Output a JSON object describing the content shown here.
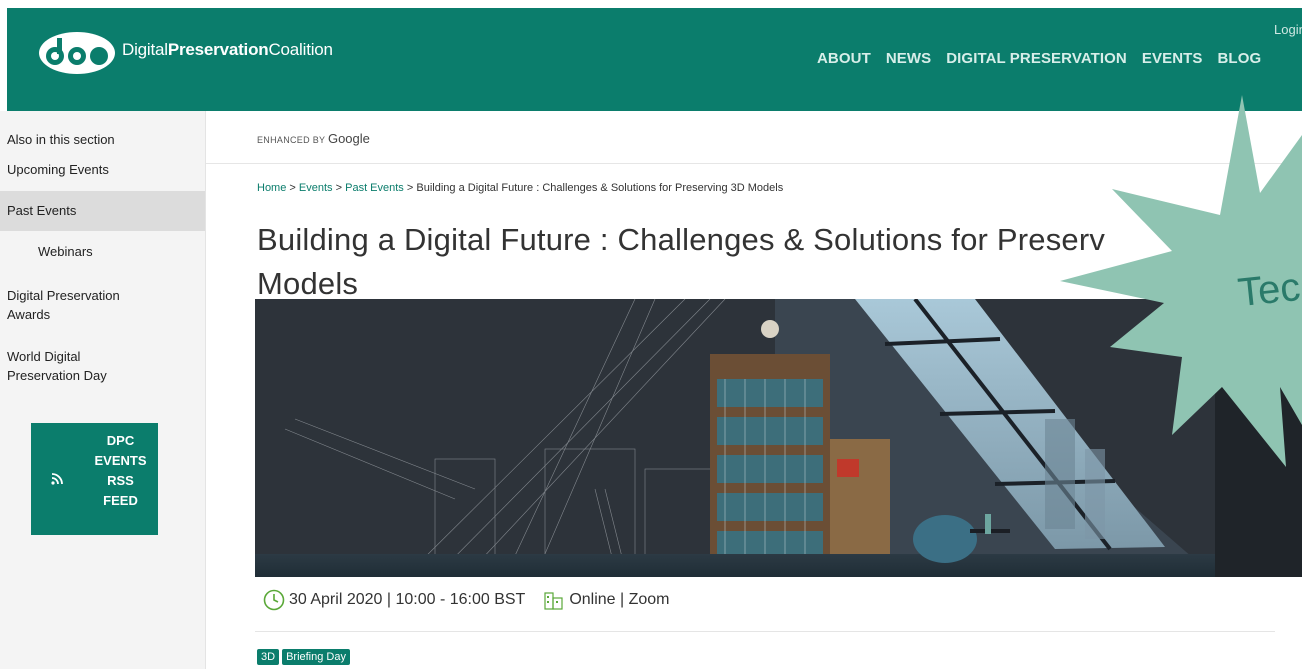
{
  "header": {
    "brand_light_1": "Digital",
    "brand_bold": "Preservation",
    "brand_light_2": "Coalition",
    "login": "Login",
    "nav": [
      "ABOUT",
      "NEWS",
      "DIGITAL PRESERVATION",
      "EVENTS",
      "BLOG"
    ]
  },
  "sidebar": {
    "heading": "Also in this section",
    "items": [
      {
        "label": "Upcoming Events"
      },
      {
        "label": "Past Events"
      },
      {
        "label": "Webinars"
      },
      {
        "label": "Digital Preservation Awards"
      },
      {
        "label": "World Digital Preservation Day"
      }
    ],
    "rss": [
      "DPC",
      "EVENTS",
      "RSS",
      "FEED"
    ]
  },
  "search": {
    "enhanced_by": "ENHANCED BY",
    "google": "Google"
  },
  "breadcrumb": {
    "home": "Home",
    "events": "Events",
    "past_events": "Past Events",
    "sep": ">",
    "current": "Building a Digital Future : Challenges & Solutions for Preserving 3D Models"
  },
  "page": {
    "title": "Building a Digital Future : Challenges & Solutions for Preserv",
    "title_line2": "Models",
    "date": "30 April 2020 | 10:00 - 16:00 BST",
    "location": "Online | Zoom",
    "tags": [
      "3D",
      "Briefing Day"
    ]
  },
  "overlay": {
    "text": "Tec"
  },
  "colors": {
    "brand": "#0b7d6c",
    "starburst": "#8fc4b2"
  }
}
